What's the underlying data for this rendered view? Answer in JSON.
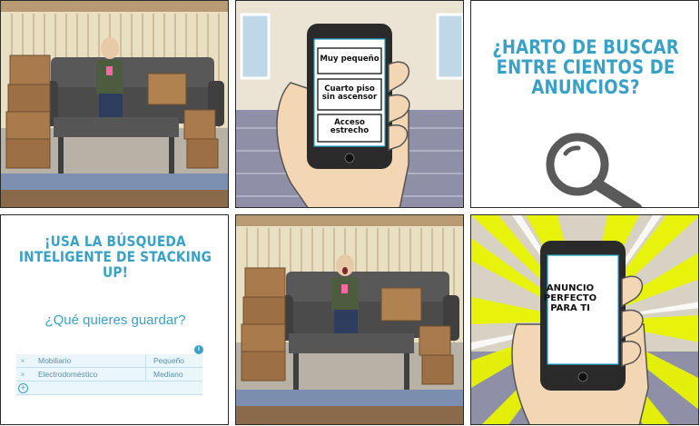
{
  "panel2": {
    "options": [
      "Muy pequeño",
      "Cuarto piso sin ascensor",
      "Acceso estrecho"
    ]
  },
  "panel3": {
    "headline": "¿HARTO DE BUSCAR ENTRE CIENTOS DE ANUNCIOS?",
    "icon": "magnifying-glass-icon"
  },
  "panel4": {
    "headline": "¡USA LA BÚSQUEDA INTELIGENTE DE STACKING UP!",
    "question": "¿Qué quieres guardar?",
    "rows": [
      {
        "remove": "×",
        "item": "Mobiliario",
        "size": "Pequeño"
      },
      {
        "remove": "×",
        "item": "Electrodoméstico",
        "size": "Mediano"
      }
    ],
    "add": "+",
    "info": "i"
  },
  "panel6": {
    "phone_text": "ANUNCIO PERFECTO PARA TI"
  },
  "colors": {
    "accent": "#3aa1c6",
    "sofa": "#585858",
    "box": "#a97a4c",
    "burst": "#e8f500"
  }
}
